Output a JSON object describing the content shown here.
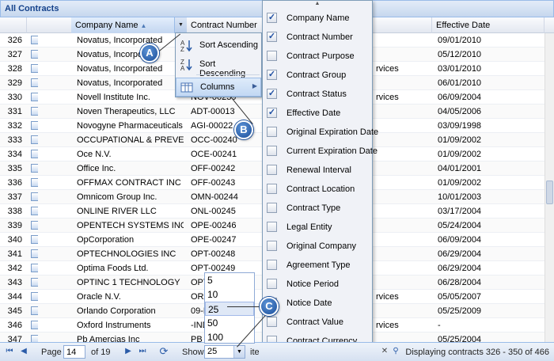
{
  "window": {
    "title": "All Contracts"
  },
  "columns": {
    "company": "Company Name",
    "contract_number": "Contract Number",
    "contract_group": "",
    "effective_date": "Effective Date"
  },
  "rows": [
    {
      "n": "326",
      "company": "Novatus, Incorporated",
      "cn": "",
      "group": "",
      "date": "09/01/2010"
    },
    {
      "n": "327",
      "company": "Novatus, Incorpora",
      "cn": "",
      "group": "",
      "date": "05/12/2010"
    },
    {
      "n": "328",
      "company": "Novatus, Incorporated",
      "cn": "",
      "group": "rvices",
      "date": "03/01/2010"
    },
    {
      "n": "329",
      "company": "Novatus, Incorporated",
      "cn": "",
      "group": "",
      "date": "06/01/2010"
    },
    {
      "n": "330",
      "company": "Novell Institute Inc.",
      "cn": "NOV-00239",
      "group": "rvices",
      "date": "06/09/2004"
    },
    {
      "n": "331",
      "company": "Noven Therapeutics, LLC",
      "cn": "ADT-00013",
      "group": "",
      "date": "04/05/2006"
    },
    {
      "n": "332",
      "company": "Novogyne Pharmaceuticals",
      "cn": "AGI-00022",
      "group": "",
      "date": "03/09/1998"
    },
    {
      "n": "333",
      "company": "OCCUPATIONAL & PREVENT...",
      "cn": "OCC-00240",
      "group": "",
      "date": "01/09/2002"
    },
    {
      "n": "334",
      "company": "Oce N.V.",
      "cn": "OCE-00241",
      "group": "",
      "date": "01/09/2002"
    },
    {
      "n": "335",
      "company": "Office Inc.",
      "cn": "OFF-00242",
      "group": "",
      "date": "04/01/2001"
    },
    {
      "n": "336",
      "company": "OFFMAX CONTRACT INC",
      "cn": "OFF-00243",
      "group": "",
      "date": "01/09/2002"
    },
    {
      "n": "337",
      "company": "Omnicom Group Inc.",
      "cn": "OMN-00244",
      "group": "",
      "date": "10/01/2003"
    },
    {
      "n": "338",
      "company": "ONLINE RIVER LLC",
      "cn": "ONL-00245",
      "group": "",
      "date": "03/17/2004"
    },
    {
      "n": "339",
      "company": "OPENTECH SYSTEMS INC",
      "cn": "OPE-00246",
      "group": "",
      "date": "05/24/2004"
    },
    {
      "n": "340",
      "company": "OpCorporation",
      "cn": "OPE-00247",
      "group": "",
      "date": "06/09/2004"
    },
    {
      "n": "341",
      "company": "OPTECHNOLOGIES INC",
      "cn": "OPT-00248",
      "group": "",
      "date": "06/29/2004"
    },
    {
      "n": "342",
      "company": "Optima Foods Ltd.",
      "cn": "OPT-00249",
      "group": "",
      "date": "06/29/2004"
    },
    {
      "n": "343",
      "company": "OPTINC 1 TECHNOLOGY",
      "cn": "OPT",
      "group": "",
      "date": "06/28/2004"
    },
    {
      "n": "344",
      "company": "Oracle N.V.",
      "cn": "ORA",
      "group": "rvices",
      "date": "05/05/2007"
    },
    {
      "n": "345",
      "company": "Orlando Corporation",
      "cn": "09-N",
      "group": "",
      "date": "05/25/2009"
    },
    {
      "n": "346",
      "company": "Oxford Instruments",
      "cn": "-IND",
      "group": "rvices",
      "date": "-"
    },
    {
      "n": "347",
      "company": "Pb Amercias Inc",
      "cn": "PB -",
      "group": "",
      "date": "05/25/2004"
    }
  ],
  "sort_menu": {
    "asc": "Sort Ascending",
    "desc": "Sort Descending",
    "columns": "Columns"
  },
  "column_menu": [
    {
      "label": "Company Name",
      "checked": true
    },
    {
      "label": "Contract Number",
      "checked": true
    },
    {
      "label": "Contract Purpose",
      "checked": false
    },
    {
      "label": "Contract Group",
      "checked": true
    },
    {
      "label": "Contract Status",
      "checked": true
    },
    {
      "label": "Effective Date",
      "checked": true
    },
    {
      "label": "Original Expiration Date",
      "checked": false
    },
    {
      "label": "Current Expiration Date",
      "checked": false
    },
    {
      "label": "Renewal Interval",
      "checked": false
    },
    {
      "label": "Contract Location",
      "checked": false
    },
    {
      "label": "Contract Type",
      "checked": false
    },
    {
      "label": "Legal Entity",
      "checked": false
    },
    {
      "label": "Original Company",
      "checked": false
    },
    {
      "label": "Agreement Type",
      "checked": false
    },
    {
      "label": "Notice Period",
      "checked": false
    },
    {
      "label": "Notice Date",
      "checked": false
    },
    {
      "label": "Contract Value",
      "checked": false
    },
    {
      "label": "Contract Currency",
      "checked": false
    }
  ],
  "page_size_options": [
    "5",
    "10",
    "25",
    "50",
    "100"
  ],
  "page_size_selected": "25",
  "pager": {
    "page_label": "Page",
    "page_value": "14",
    "of_label": "of 19",
    "show_label": "Show",
    "show_value": "25",
    "items_label": "ite",
    "display": "Displaying contracts 326 - 350 of 466"
  },
  "callouts": {
    "a": "A",
    "b": "B",
    "c": "C"
  },
  "icons": {
    "sort_asc": "sort-ascending-icon",
    "sort_desc": "sort-descending-icon",
    "columns": "columns-icon",
    "first": "first-page-icon",
    "prev": "prev-page-icon",
    "next": "next-page-icon",
    "last": "last-page-icon",
    "refresh": "refresh-icon"
  }
}
